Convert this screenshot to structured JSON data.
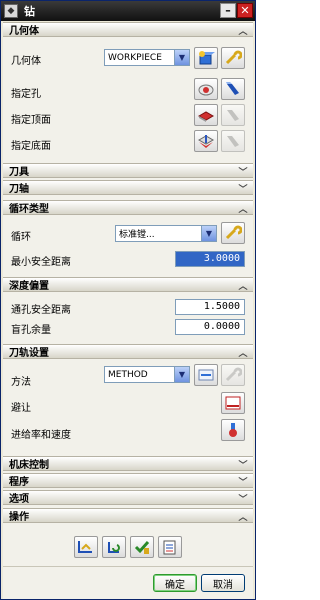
{
  "window": {
    "title": "钻",
    "minimize_label": "–",
    "close_label": "✕"
  },
  "sections": {
    "geometry": {
      "label": "几何体",
      "state": "expanded"
    },
    "tool": {
      "label": "刀具",
      "state": "collapsed"
    },
    "axis": {
      "label": "刀轴",
      "state": "collapsed"
    },
    "cycle_type": {
      "label": "循环类型",
      "state": "expanded"
    },
    "depth_offset": {
      "label": "深度偏置",
      "state": "expanded"
    },
    "path_settings": {
      "label": "刀轨设置",
      "state": "expanded"
    },
    "machine_control": {
      "label": "机床控制",
      "state": "collapsed"
    },
    "program": {
      "label": "程序",
      "state": "collapsed"
    },
    "options": {
      "label": "选项",
      "state": "collapsed"
    },
    "actions": {
      "label": "操作",
      "state": "expanded"
    }
  },
  "geometry": {
    "geometry_label": "几何体",
    "geometry_value": "WORKPIECE",
    "hole_label": "指定孔",
    "top_label": "指定顶面",
    "bottom_label": "指定底面"
  },
  "cycle": {
    "cycle_label": "循环",
    "cycle_value": "标准镗...",
    "min_clearance_label": "最小安全距离",
    "min_clearance_value": "3.0000"
  },
  "depth": {
    "through_clearance_label": "通孔安全距离",
    "through_clearance_value": "1.5000",
    "blind_stock_label": "盲孔余量",
    "blind_stock_value": "0.0000"
  },
  "path": {
    "method_label": "方法",
    "method_value": "METHOD",
    "avoid_label": "避让",
    "feeds_label": "进给率和速度"
  },
  "buttons": {
    "ok_label": "确定",
    "cancel_label": "取消"
  },
  "colors": {
    "title_bar": "#1a1a1a",
    "selected_input": "#3166c5",
    "default_button_border": "#2e9a2e"
  }
}
